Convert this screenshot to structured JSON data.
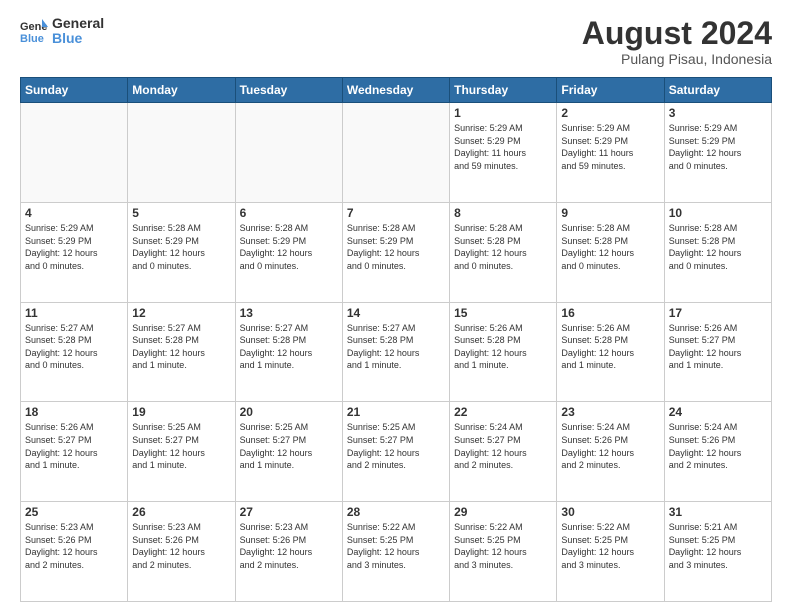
{
  "logo": {
    "line1": "General",
    "line2": "Blue"
  },
  "header": {
    "month_year": "August 2024",
    "location": "Pulang Pisau, Indonesia"
  },
  "weekdays": [
    "Sunday",
    "Monday",
    "Tuesday",
    "Wednesday",
    "Thursday",
    "Friday",
    "Saturday"
  ],
  "weeks": [
    [
      {
        "day": "",
        "info": ""
      },
      {
        "day": "",
        "info": ""
      },
      {
        "day": "",
        "info": ""
      },
      {
        "day": "",
        "info": ""
      },
      {
        "day": "1",
        "info": "Sunrise: 5:29 AM\nSunset: 5:29 PM\nDaylight: 11 hours\nand 59 minutes."
      },
      {
        "day": "2",
        "info": "Sunrise: 5:29 AM\nSunset: 5:29 PM\nDaylight: 11 hours\nand 59 minutes."
      },
      {
        "day": "3",
        "info": "Sunrise: 5:29 AM\nSunset: 5:29 PM\nDaylight: 12 hours\nand 0 minutes."
      }
    ],
    [
      {
        "day": "4",
        "info": "Sunrise: 5:29 AM\nSunset: 5:29 PM\nDaylight: 12 hours\nand 0 minutes."
      },
      {
        "day": "5",
        "info": "Sunrise: 5:28 AM\nSunset: 5:29 PM\nDaylight: 12 hours\nand 0 minutes."
      },
      {
        "day": "6",
        "info": "Sunrise: 5:28 AM\nSunset: 5:29 PM\nDaylight: 12 hours\nand 0 minutes."
      },
      {
        "day": "7",
        "info": "Sunrise: 5:28 AM\nSunset: 5:29 PM\nDaylight: 12 hours\nand 0 minutes."
      },
      {
        "day": "8",
        "info": "Sunrise: 5:28 AM\nSunset: 5:28 PM\nDaylight: 12 hours\nand 0 minutes."
      },
      {
        "day": "9",
        "info": "Sunrise: 5:28 AM\nSunset: 5:28 PM\nDaylight: 12 hours\nand 0 minutes."
      },
      {
        "day": "10",
        "info": "Sunrise: 5:28 AM\nSunset: 5:28 PM\nDaylight: 12 hours\nand 0 minutes."
      }
    ],
    [
      {
        "day": "11",
        "info": "Sunrise: 5:27 AM\nSunset: 5:28 PM\nDaylight: 12 hours\nand 0 minutes."
      },
      {
        "day": "12",
        "info": "Sunrise: 5:27 AM\nSunset: 5:28 PM\nDaylight: 12 hours\nand 1 minute."
      },
      {
        "day": "13",
        "info": "Sunrise: 5:27 AM\nSunset: 5:28 PM\nDaylight: 12 hours\nand 1 minute."
      },
      {
        "day": "14",
        "info": "Sunrise: 5:27 AM\nSunset: 5:28 PM\nDaylight: 12 hours\nand 1 minute."
      },
      {
        "day": "15",
        "info": "Sunrise: 5:26 AM\nSunset: 5:28 PM\nDaylight: 12 hours\nand 1 minute."
      },
      {
        "day": "16",
        "info": "Sunrise: 5:26 AM\nSunset: 5:28 PM\nDaylight: 12 hours\nand 1 minute."
      },
      {
        "day": "17",
        "info": "Sunrise: 5:26 AM\nSunset: 5:27 PM\nDaylight: 12 hours\nand 1 minute."
      }
    ],
    [
      {
        "day": "18",
        "info": "Sunrise: 5:26 AM\nSunset: 5:27 PM\nDaylight: 12 hours\nand 1 minute."
      },
      {
        "day": "19",
        "info": "Sunrise: 5:25 AM\nSunset: 5:27 PM\nDaylight: 12 hours\nand 1 minute."
      },
      {
        "day": "20",
        "info": "Sunrise: 5:25 AM\nSunset: 5:27 PM\nDaylight: 12 hours\nand 1 minute."
      },
      {
        "day": "21",
        "info": "Sunrise: 5:25 AM\nSunset: 5:27 PM\nDaylight: 12 hours\nand 2 minutes."
      },
      {
        "day": "22",
        "info": "Sunrise: 5:24 AM\nSunset: 5:27 PM\nDaylight: 12 hours\nand 2 minutes."
      },
      {
        "day": "23",
        "info": "Sunrise: 5:24 AM\nSunset: 5:26 PM\nDaylight: 12 hours\nand 2 minutes."
      },
      {
        "day": "24",
        "info": "Sunrise: 5:24 AM\nSunset: 5:26 PM\nDaylight: 12 hours\nand 2 minutes."
      }
    ],
    [
      {
        "day": "25",
        "info": "Sunrise: 5:23 AM\nSunset: 5:26 PM\nDaylight: 12 hours\nand 2 minutes."
      },
      {
        "day": "26",
        "info": "Sunrise: 5:23 AM\nSunset: 5:26 PM\nDaylight: 12 hours\nand 2 minutes."
      },
      {
        "day": "27",
        "info": "Sunrise: 5:23 AM\nSunset: 5:26 PM\nDaylight: 12 hours\nand 2 minutes."
      },
      {
        "day": "28",
        "info": "Sunrise: 5:22 AM\nSunset: 5:25 PM\nDaylight: 12 hours\nand 3 minutes."
      },
      {
        "day": "29",
        "info": "Sunrise: 5:22 AM\nSunset: 5:25 PM\nDaylight: 12 hours\nand 3 minutes."
      },
      {
        "day": "30",
        "info": "Sunrise: 5:22 AM\nSunset: 5:25 PM\nDaylight: 12 hours\nand 3 minutes."
      },
      {
        "day": "31",
        "info": "Sunrise: 5:21 AM\nSunset: 5:25 PM\nDaylight: 12 hours\nand 3 minutes."
      }
    ]
  ]
}
